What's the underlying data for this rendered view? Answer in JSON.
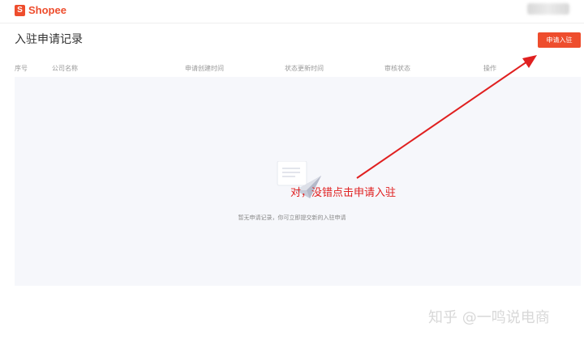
{
  "brand": {
    "logo_letter": "S",
    "logo_text": "Shopee",
    "accent": "#ee4d2d"
  },
  "page": {
    "title": "入驻申请记录",
    "apply_button": "申请入驻"
  },
  "table": {
    "columns": [
      "序号",
      "公司名称",
      "申请创建时间",
      "状态更新时间",
      "审核状态",
      "操作"
    ],
    "empty_text": "暂无申请记录，你可立即提交新的入驻申请"
  },
  "annotation": {
    "text": "对，没错点击申请入驻",
    "color": "#e02020"
  },
  "watermark": {
    "text": "知乎 @一鸣说电商"
  },
  "icons": [
    "empty-document-icon",
    "paper-plane-icon",
    "arrow-pointer"
  ]
}
